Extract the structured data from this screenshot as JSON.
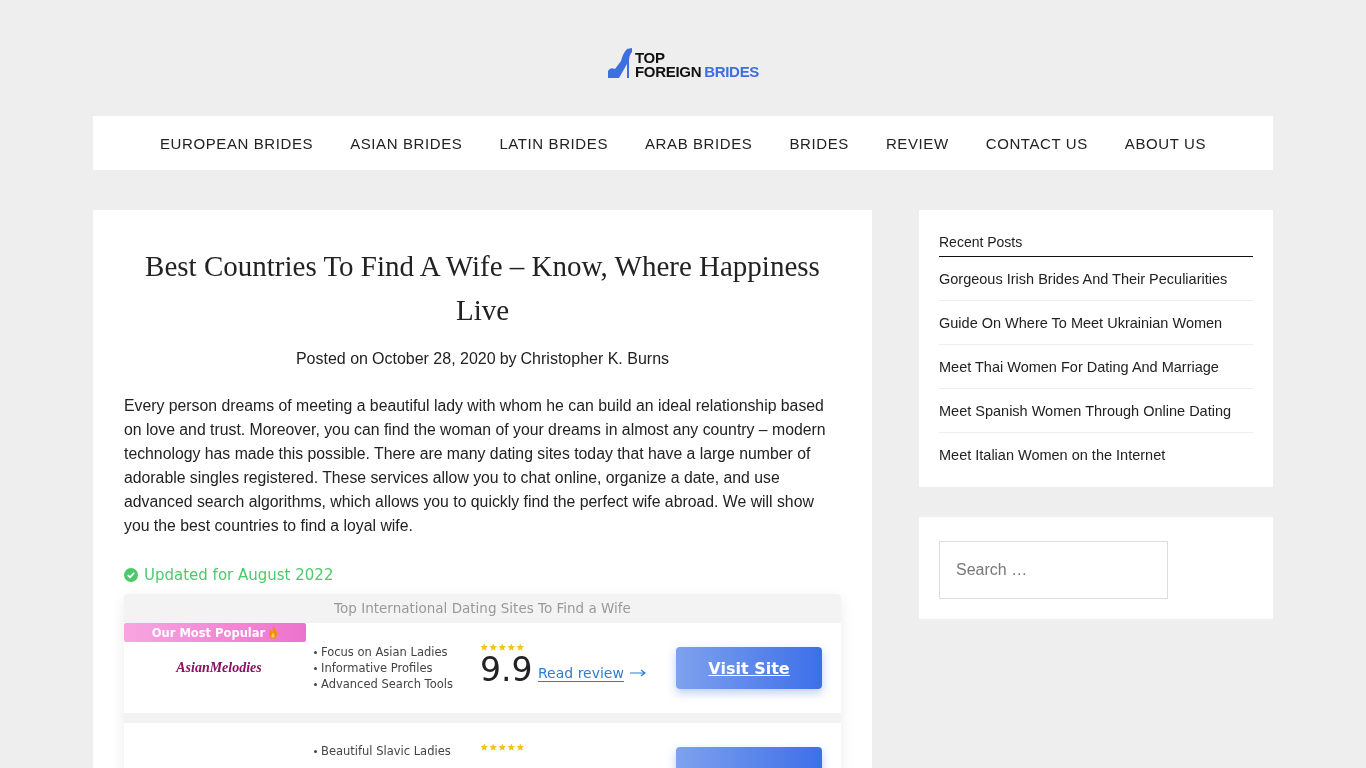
{
  "logo": {
    "top": "TOP",
    "foreign": "FOREIGN",
    "brides": "BRIDES"
  },
  "nav": [
    "EUROPEAN BRIDES",
    "ASIAN BRIDES",
    "LATIN BRIDES",
    "ARAB BRIDES",
    "BRIDES",
    "REVIEW",
    "CONTACT US",
    "ABOUT US"
  ],
  "article": {
    "title": "Best Countries To Find A Wife – Know, Where Happiness Live",
    "posted_prefix": "Posted on",
    "date": "October 28, 2020",
    "by": "by",
    "author": "Christopher K. Burns",
    "body": "Every person dreams of meeting a beautiful lady with whom he can build an ideal relationship based on love and trust. Moreover, you can find the woman of your dreams in almost any country – modern technology has made this possible. There are many dating sites today that have a large number of adorable singles registered. These services allow you to chat online, organize a date, and use advanced search algorithms, which allows you to quickly find the perfect wife abroad. We will show you the best countries to find a loyal wife.",
    "updated": "Updated for August 2022",
    "table_title": "Top International Dating Sites To Find a Wife",
    "offers": [
      {
        "badge": "Our Most Popular",
        "logo": "AsianMelodies",
        "features": [
          "Focus on Asian Ladies",
          "Informative Profiles",
          "Advanced Search Tools"
        ],
        "stars": 5,
        "score": "9.9",
        "review_link": "Read review",
        "button": "Visit Site"
      },
      {
        "features": [
          "Beautiful Slavic Ladies"
        ],
        "stars": 5
      }
    ]
  },
  "sidebar": {
    "recent_title": "Recent Posts",
    "recent_posts": [
      "Gorgeous Irish Brides And Their Peculiarities",
      "Guide On Where To Meet Ukrainian Women",
      "Meet Thai Women For Dating And Marriage",
      "Meet Spanish Women Through Online Dating",
      "Meet Italian Women on the Internet"
    ],
    "search": {
      "placeholder": "Search …"
    }
  }
}
